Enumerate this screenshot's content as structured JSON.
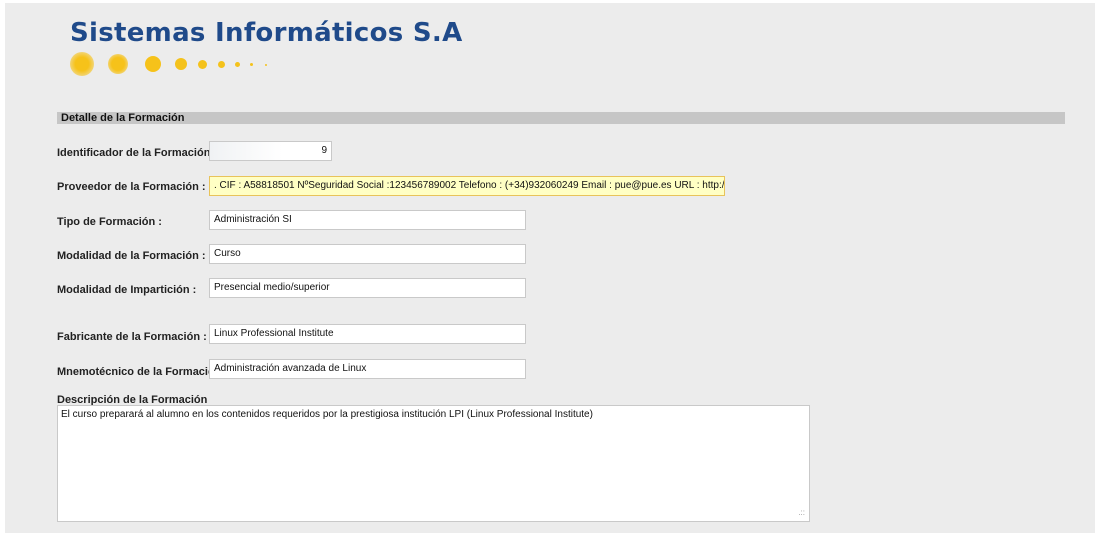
{
  "brand": {
    "title": "Sistemas Informáticos S.A"
  },
  "section": {
    "title": "Detalle de la Formación"
  },
  "fields": {
    "identificador": {
      "label": "Identificador de la Formación :",
      "value": "9"
    },
    "proveedor": {
      "label": "Proveedor de la Formación :",
      "value": ". CIF : A58818501 NºSeguridad Social :123456789002 Telefono : (+34)932060249 Email : pue@pue.es  URL : http://www.pue.es"
    },
    "tipo": {
      "label": "Tipo de Formación :",
      "value": "Administración SI"
    },
    "modalidad_formacion": {
      "label": "Modalidad de la Formación :",
      "value": "Curso"
    },
    "modalidad_imparticion": {
      "label": "Modalidad de Impartición :",
      "value": "Presencial medio/superior"
    },
    "fabricante": {
      "label": "Fabricante de la Formación :",
      "value": "Linux Professional Institute"
    },
    "mnemotecnico": {
      "label": "Mnemotécnico de la Formacion :",
      "value": "Administración avanzada de Linux"
    }
  },
  "descripcion": {
    "label": "Descripción de la Formación",
    "value": "El curso preparará al alumno en los contenidos requeridos por la prestigiosa institución LPI (Linux Professional Institute)"
  },
  "colors": {
    "brand_blue": "#1f4a8a",
    "dot_yellow": "#f4c21c",
    "highlight": "#ffffc4"
  }
}
